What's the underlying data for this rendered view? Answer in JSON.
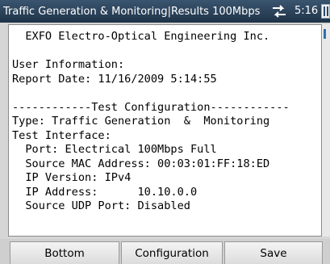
{
  "titlebar": {
    "title": "Traffic Generation  &  Monitoring|Results 100Mbps",
    "status_icon": "traffic-arrows-icon",
    "time": "5:16",
    "battery_icon": "battery-icon"
  },
  "report": {
    "lines": [
      "  EXFO Electro-Optical Engineering Inc.",
      "",
      "User Information:",
      "Report Date: 11/16/2009 5:14:55",
      "",
      "------------Test Configuration------------",
      "Type: Traffic Generation  &  Monitoring",
      "Test Interface:",
      "  Port: Electrical 100Mbps Full",
      "  Source MAC Address: 00:03:01:FF:18:ED",
      "  IP Version: IPv4",
      "  IP Address:      10.10.0.0",
      "  Source UDP Port: Disabled"
    ]
  },
  "buttons": {
    "bottom": "Bottom",
    "configuration": "Configuration",
    "save": "Save"
  },
  "colors": {
    "titlebar": "#2b4a68",
    "background": "#d6d6d6",
    "report_bg": "#ffffff"
  }
}
